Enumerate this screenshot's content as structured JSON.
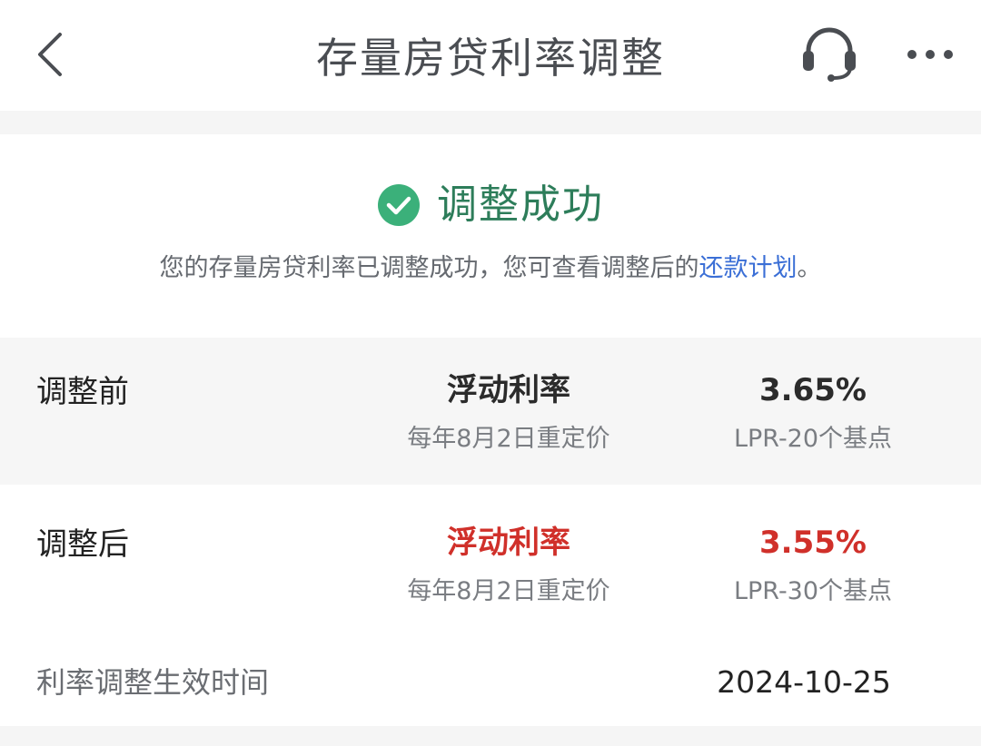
{
  "nav": {
    "title": "存量房贷利率调整"
  },
  "icons": {
    "back": "chevron-left-icon",
    "service": "headset-icon",
    "more": "more-dots-icon",
    "success": "check-circle-icon"
  },
  "colors": {
    "success_green": "#2d7d5a",
    "check_circle": "#3bb07a",
    "accent_red": "#d0302a",
    "link_blue": "#3b6fd6"
  },
  "result": {
    "title": "调整成功",
    "desc_before_link": "您的存量房贷利率已调整成功，您可查看调整后的",
    "link_text": "还款计划",
    "desc_after_link": "。"
  },
  "rows": [
    {
      "label": "调整前",
      "rate_type": "浮动利率",
      "reprice_note": "每年8月2日重定价",
      "rate": "3.65%",
      "rate_formula": "LPR-20个基点"
    },
    {
      "label": "调整后",
      "rate_type": "浮动利率",
      "reprice_note": "每年8月2日重定价",
      "rate": "3.55%",
      "rate_formula": "LPR-30个基点"
    }
  ],
  "effective": {
    "label": "利率调整生效时间",
    "value": "2024-10-25"
  }
}
